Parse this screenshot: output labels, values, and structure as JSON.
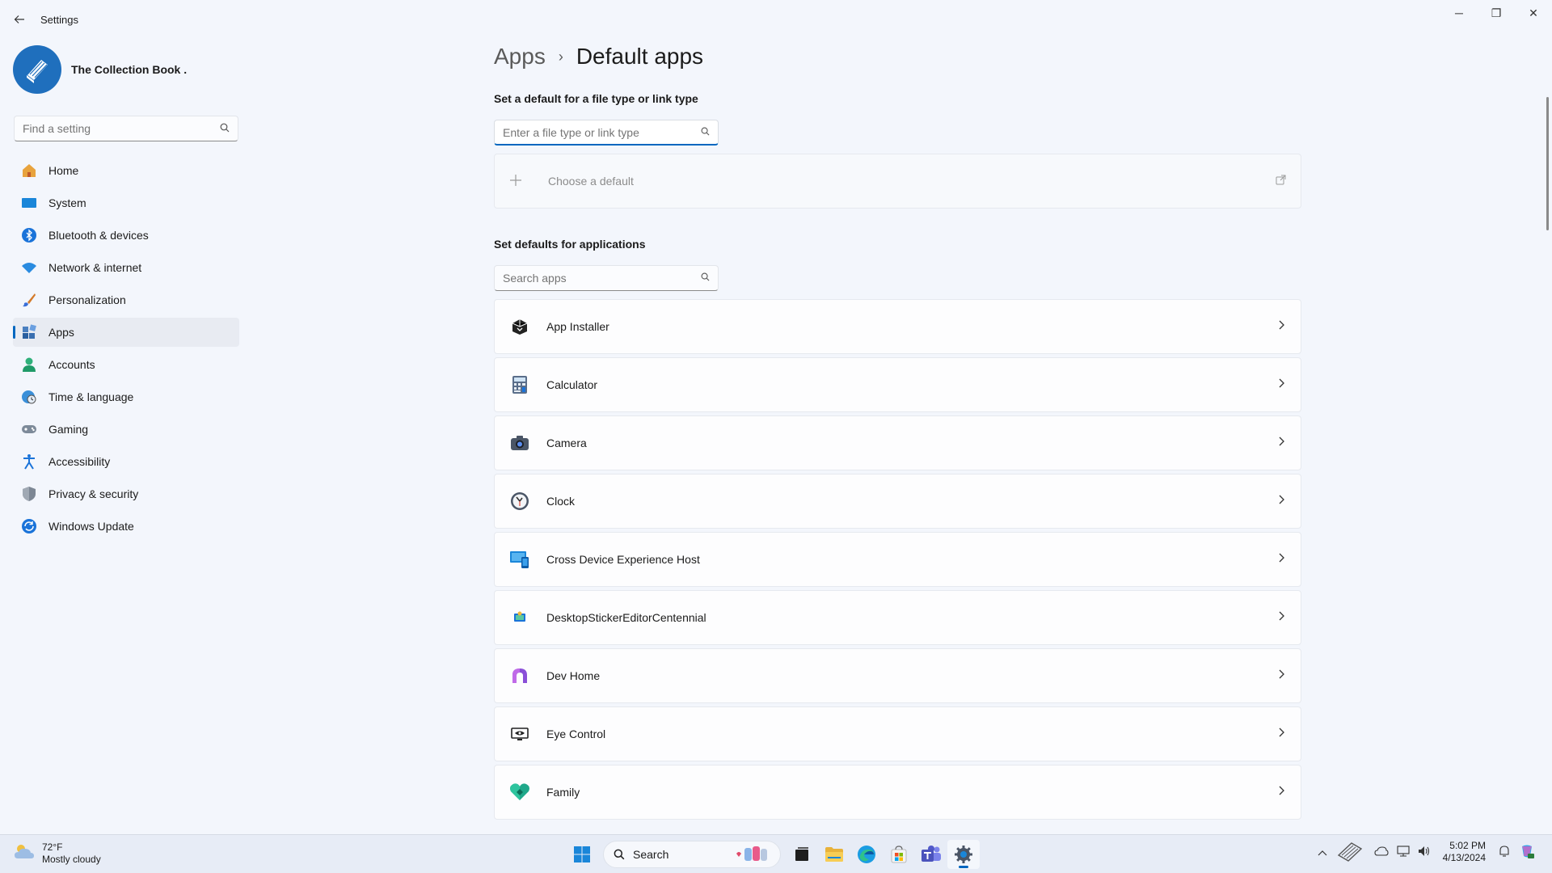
{
  "window": {
    "title": "Settings",
    "minimize": "─",
    "maximize": "❐",
    "close": "✕"
  },
  "profile": {
    "name": "The Collection Book ."
  },
  "sidebar": {
    "search_placeholder": "Find a setting",
    "items": [
      {
        "label": "Home",
        "icon": "home-icon"
      },
      {
        "label": "System",
        "icon": "system-icon"
      },
      {
        "label": "Bluetooth & devices",
        "icon": "bluetooth-icon"
      },
      {
        "label": "Network & internet",
        "icon": "wifi-icon"
      },
      {
        "label": "Personalization",
        "icon": "brush-icon"
      },
      {
        "label": "Apps",
        "icon": "apps-icon",
        "active": true
      },
      {
        "label": "Accounts",
        "icon": "person-icon"
      },
      {
        "label": "Time & language",
        "icon": "globe-clock-icon"
      },
      {
        "label": "Gaming",
        "icon": "gamepad-icon"
      },
      {
        "label": "Accessibility",
        "icon": "accessibility-icon"
      },
      {
        "label": "Privacy & security",
        "icon": "shield-icon"
      },
      {
        "label": "Windows Update",
        "icon": "update-icon"
      }
    ]
  },
  "main": {
    "breadcrumb": {
      "parent": "Apps",
      "separator": "›",
      "current": "Default apps"
    },
    "filetype_section": {
      "heading": "Set a default for a file type or link type",
      "placeholder": "Enter a file type or link type",
      "choose_label": "Choose a default"
    },
    "apps_section": {
      "heading": "Set defaults for applications",
      "placeholder": "Search apps",
      "apps": [
        {
          "name": "App Installer",
          "icon": "app-installer-icon"
        },
        {
          "name": "Calculator",
          "icon": "calculator-icon"
        },
        {
          "name": "Camera",
          "icon": "camera-icon"
        },
        {
          "name": "Clock",
          "icon": "clock-icon"
        },
        {
          "name": "Cross Device Experience Host",
          "icon": "cross-device-icon"
        },
        {
          "name": "DesktopStickerEditorCentennial",
          "icon": "sticker-editor-icon"
        },
        {
          "name": "Dev Home",
          "icon": "dev-home-icon"
        },
        {
          "name": "Eye Control",
          "icon": "eye-control-icon"
        },
        {
          "name": "Family",
          "icon": "family-icon"
        }
      ]
    }
  },
  "taskbar": {
    "weather_temp": "72°F",
    "weather_desc": "Mostly cloudy",
    "search_label": "Search",
    "time": "5:02 PM",
    "date": "4/13/2024"
  },
  "colors": {
    "accent": "#0067c0",
    "background": "#f3f6fc"
  }
}
